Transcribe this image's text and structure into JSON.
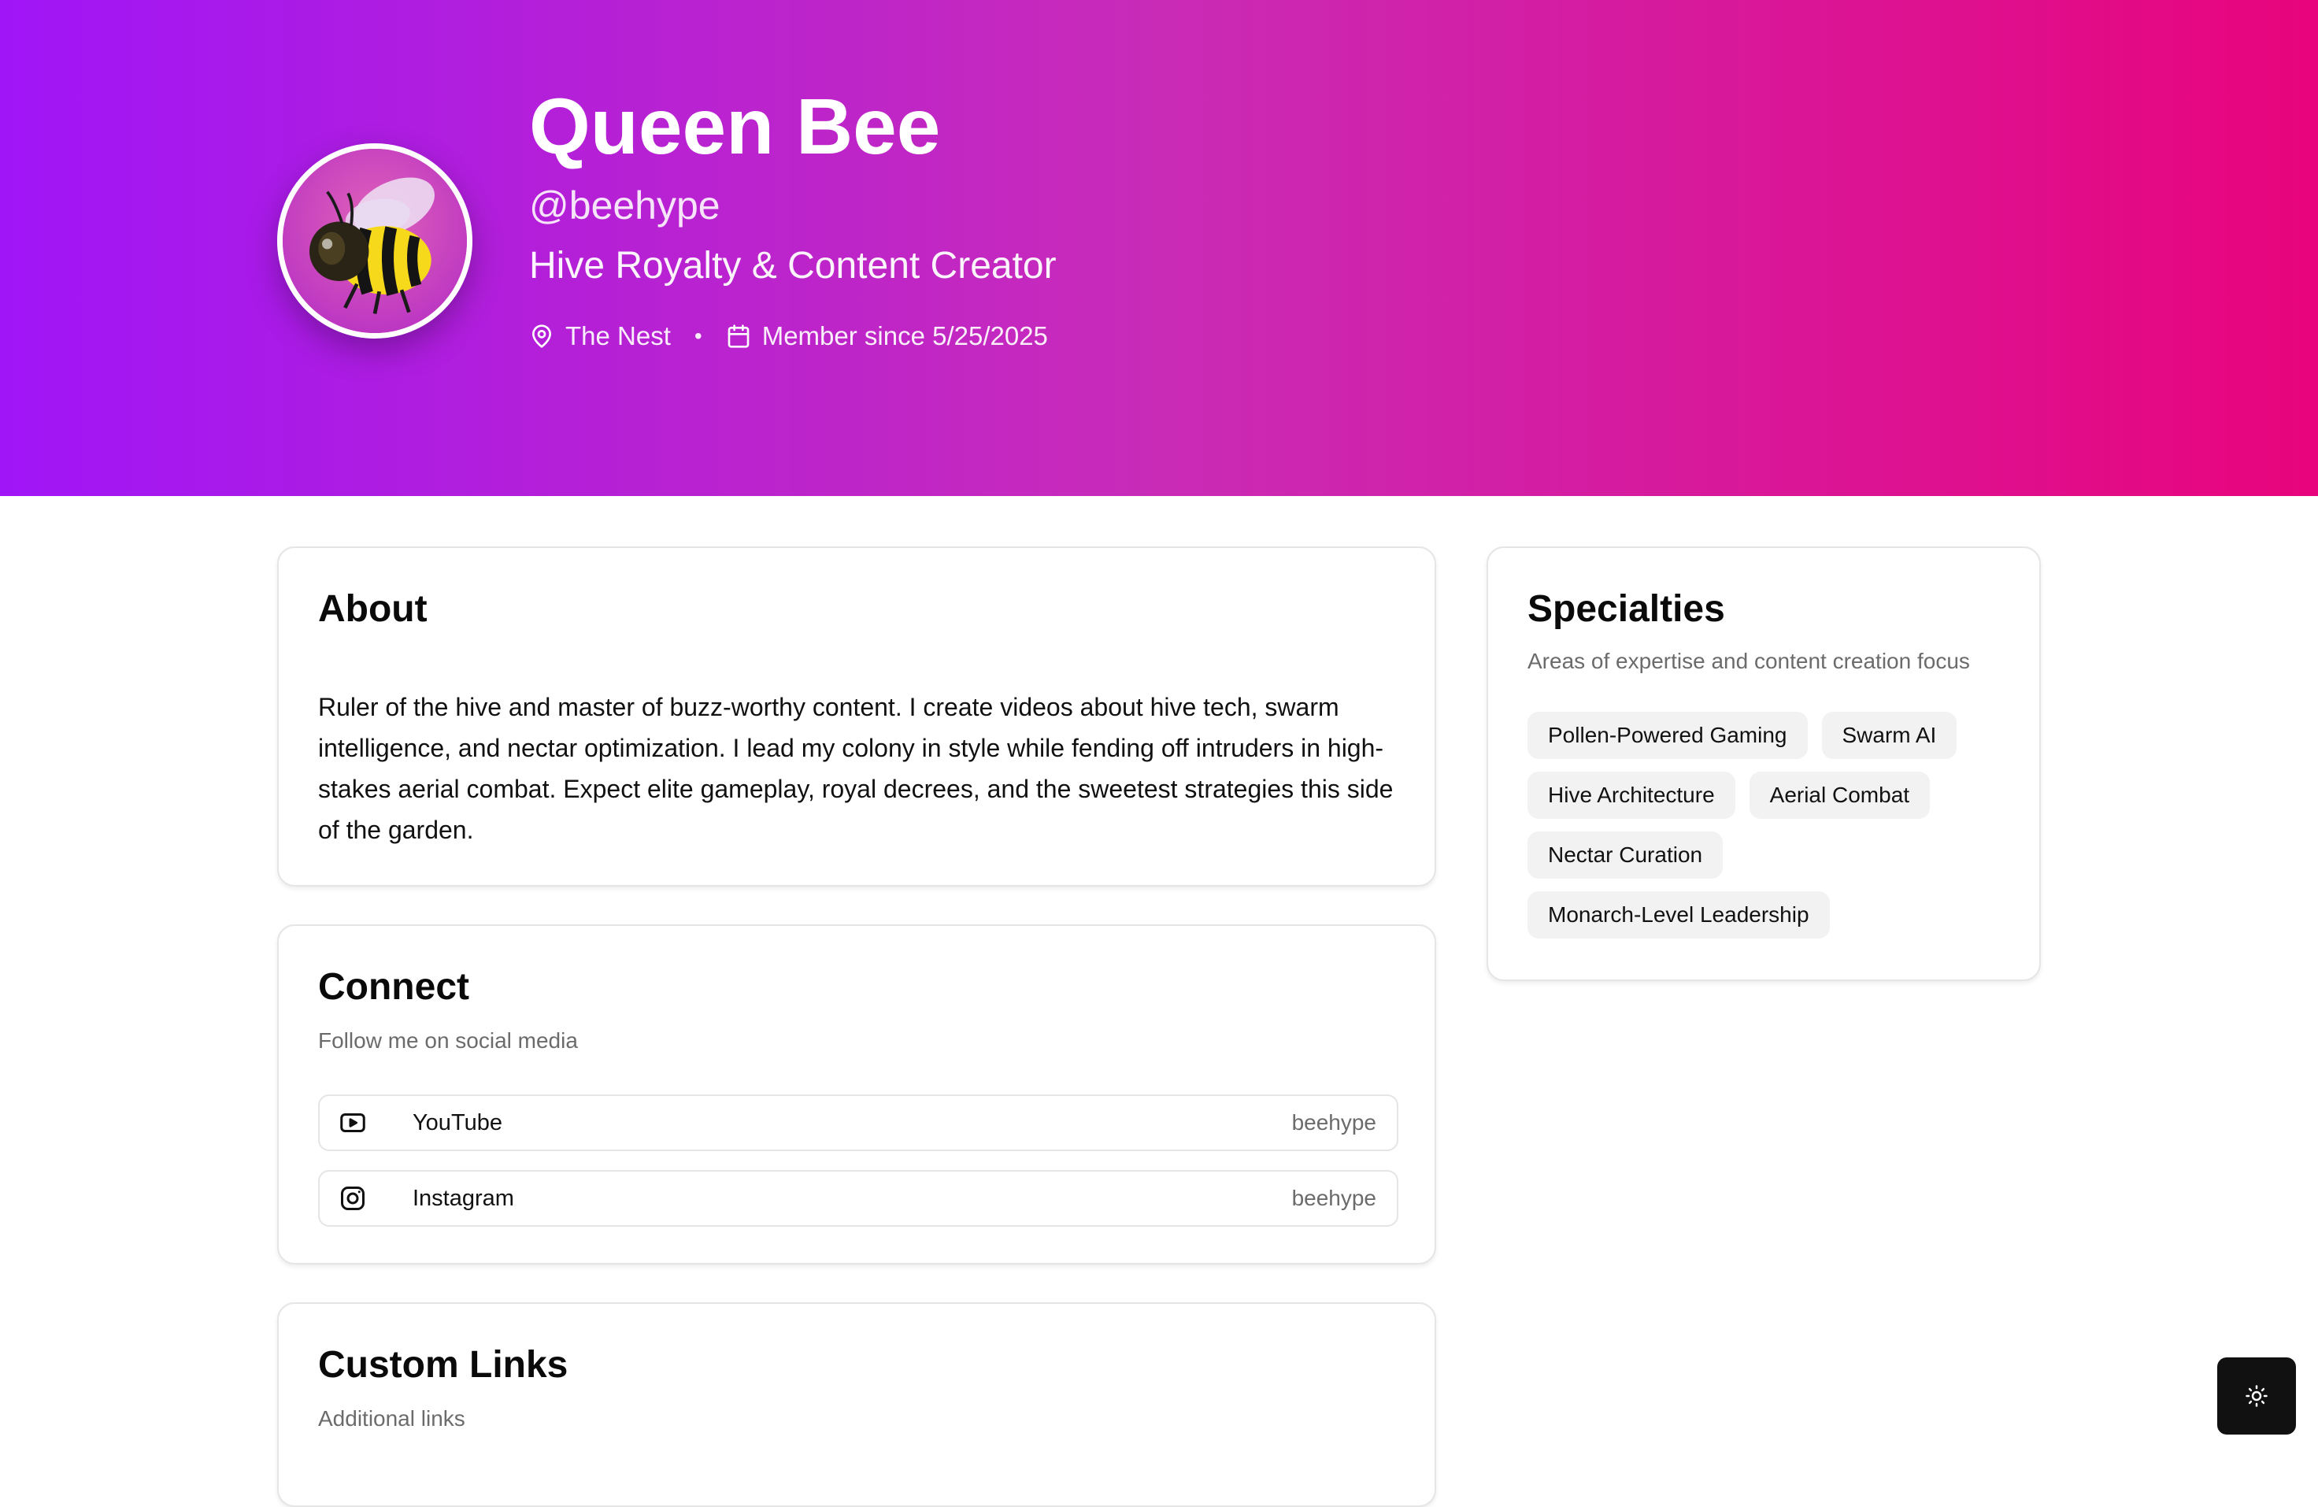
{
  "profile": {
    "name": "Queen Bee",
    "handle": "@beehype",
    "tagline": "Hive Royalty & Content Creator",
    "location": "The Nest",
    "member_since": "Member since 5/25/2025",
    "separator": "•",
    "avatar_icon": "bee-avatar"
  },
  "about": {
    "title": "About",
    "text": "Ruler of the hive and master of buzz-worthy content. I create videos about hive tech, swarm intelligence, and nectar optimization. I lead my colony in style while fending off intruders in high-stakes aerial combat. Expect elite gameplay, royal decrees, and the sweetest strategies this side of the garden."
  },
  "connect": {
    "title": "Connect",
    "subtitle": "Follow me on social media",
    "links": [
      {
        "platform": "YouTube",
        "username": "beehype",
        "icon": "youtube-icon"
      },
      {
        "platform": "Instagram",
        "username": "beehype",
        "icon": "instagram-icon"
      }
    ]
  },
  "custom_links": {
    "title": "Custom Links",
    "subtitle": "Additional links"
  },
  "specialties": {
    "title": "Specialties",
    "subtitle": "Areas of expertise and content creation focus",
    "tags": [
      "Pollen-Powered Gaming",
      "Swarm AI",
      "Hive Architecture",
      "Aerial Combat",
      "Nectar Curation",
      "Monarch-Level Leadership"
    ]
  },
  "theme_toggle": {
    "icon": "sun-icon"
  },
  "colors": {
    "hero_gradient_start": "#a015f7",
    "hero_gradient_end": "#e8047c",
    "tag_background": "#f2f2f2",
    "theme_button": "#111111"
  }
}
